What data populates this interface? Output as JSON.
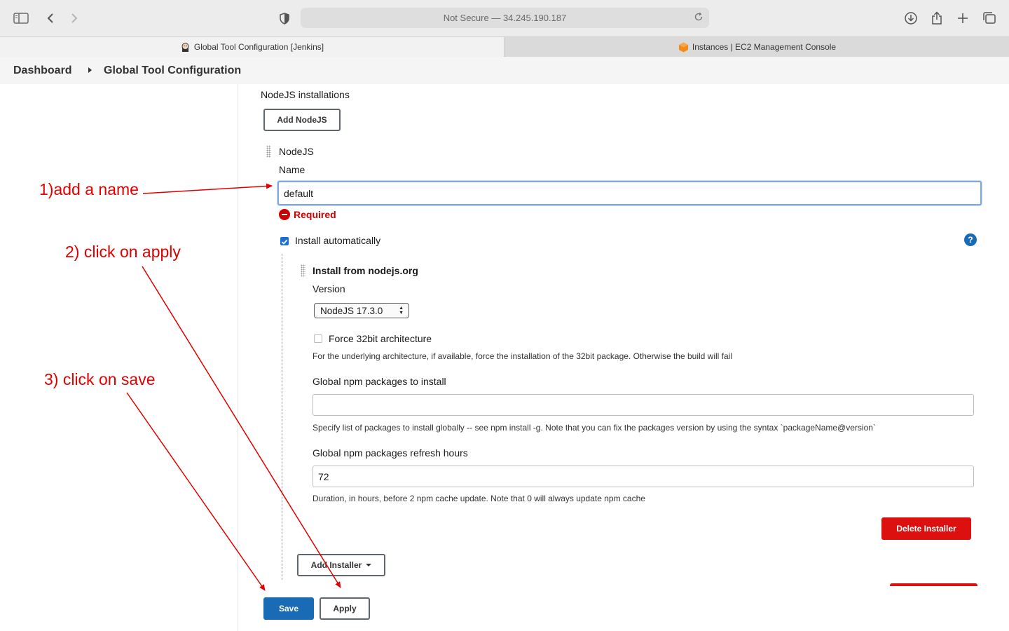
{
  "browser": {
    "address": "Not Secure — 34.245.190.187",
    "tabs": [
      {
        "label": "Global Tool Configuration [Jenkins]",
        "active": true
      },
      {
        "label": "Instances | EC2 Management Console",
        "active": false
      }
    ]
  },
  "breadcrumb": {
    "items": [
      "Dashboard",
      "Global Tool Configuration"
    ]
  },
  "section": {
    "title": "NodeJS installations",
    "add_button": "Add NodeJS"
  },
  "installation": {
    "header": "NodeJS",
    "name_label": "Name",
    "name_value": "default",
    "required_text": "Required",
    "install_auto_label": "Install automatically",
    "install_auto_checked": true,
    "installer": {
      "title": "Install from nodejs.org",
      "version_label": "Version",
      "version_value": "NodeJS 17.3.0",
      "force32_label": "Force 32bit architecture",
      "force32_checked": false,
      "force32_help": "For the underlying architecture, if available, force the installation of the 32bit package. Otherwise the build will fail",
      "npm_packages_label": "Global npm packages to install",
      "npm_packages_value": "",
      "npm_packages_help": "Specify list of packages to install globally -- see npm install -g. Note that you can fix the packages version by using the syntax `packageName@version`",
      "refresh_label": "Global npm packages refresh hours",
      "refresh_value": "72",
      "refresh_help": "Duration, in hours, before 2 npm cache update. Note that 0 will always update npm cache",
      "delete_button": "Delete Installer"
    },
    "add_installer_button": "Add Installer"
  },
  "actions": {
    "save": "Save",
    "apply": "Apply"
  },
  "annotations": {
    "step1": "1)add a name",
    "step2": "2) click on apply",
    "step3": "3) click on save",
    "color": "#e00000"
  },
  "colors": {
    "primary": "#1a6bb5",
    "danger": "#dd1010",
    "required": "#cc0000"
  }
}
